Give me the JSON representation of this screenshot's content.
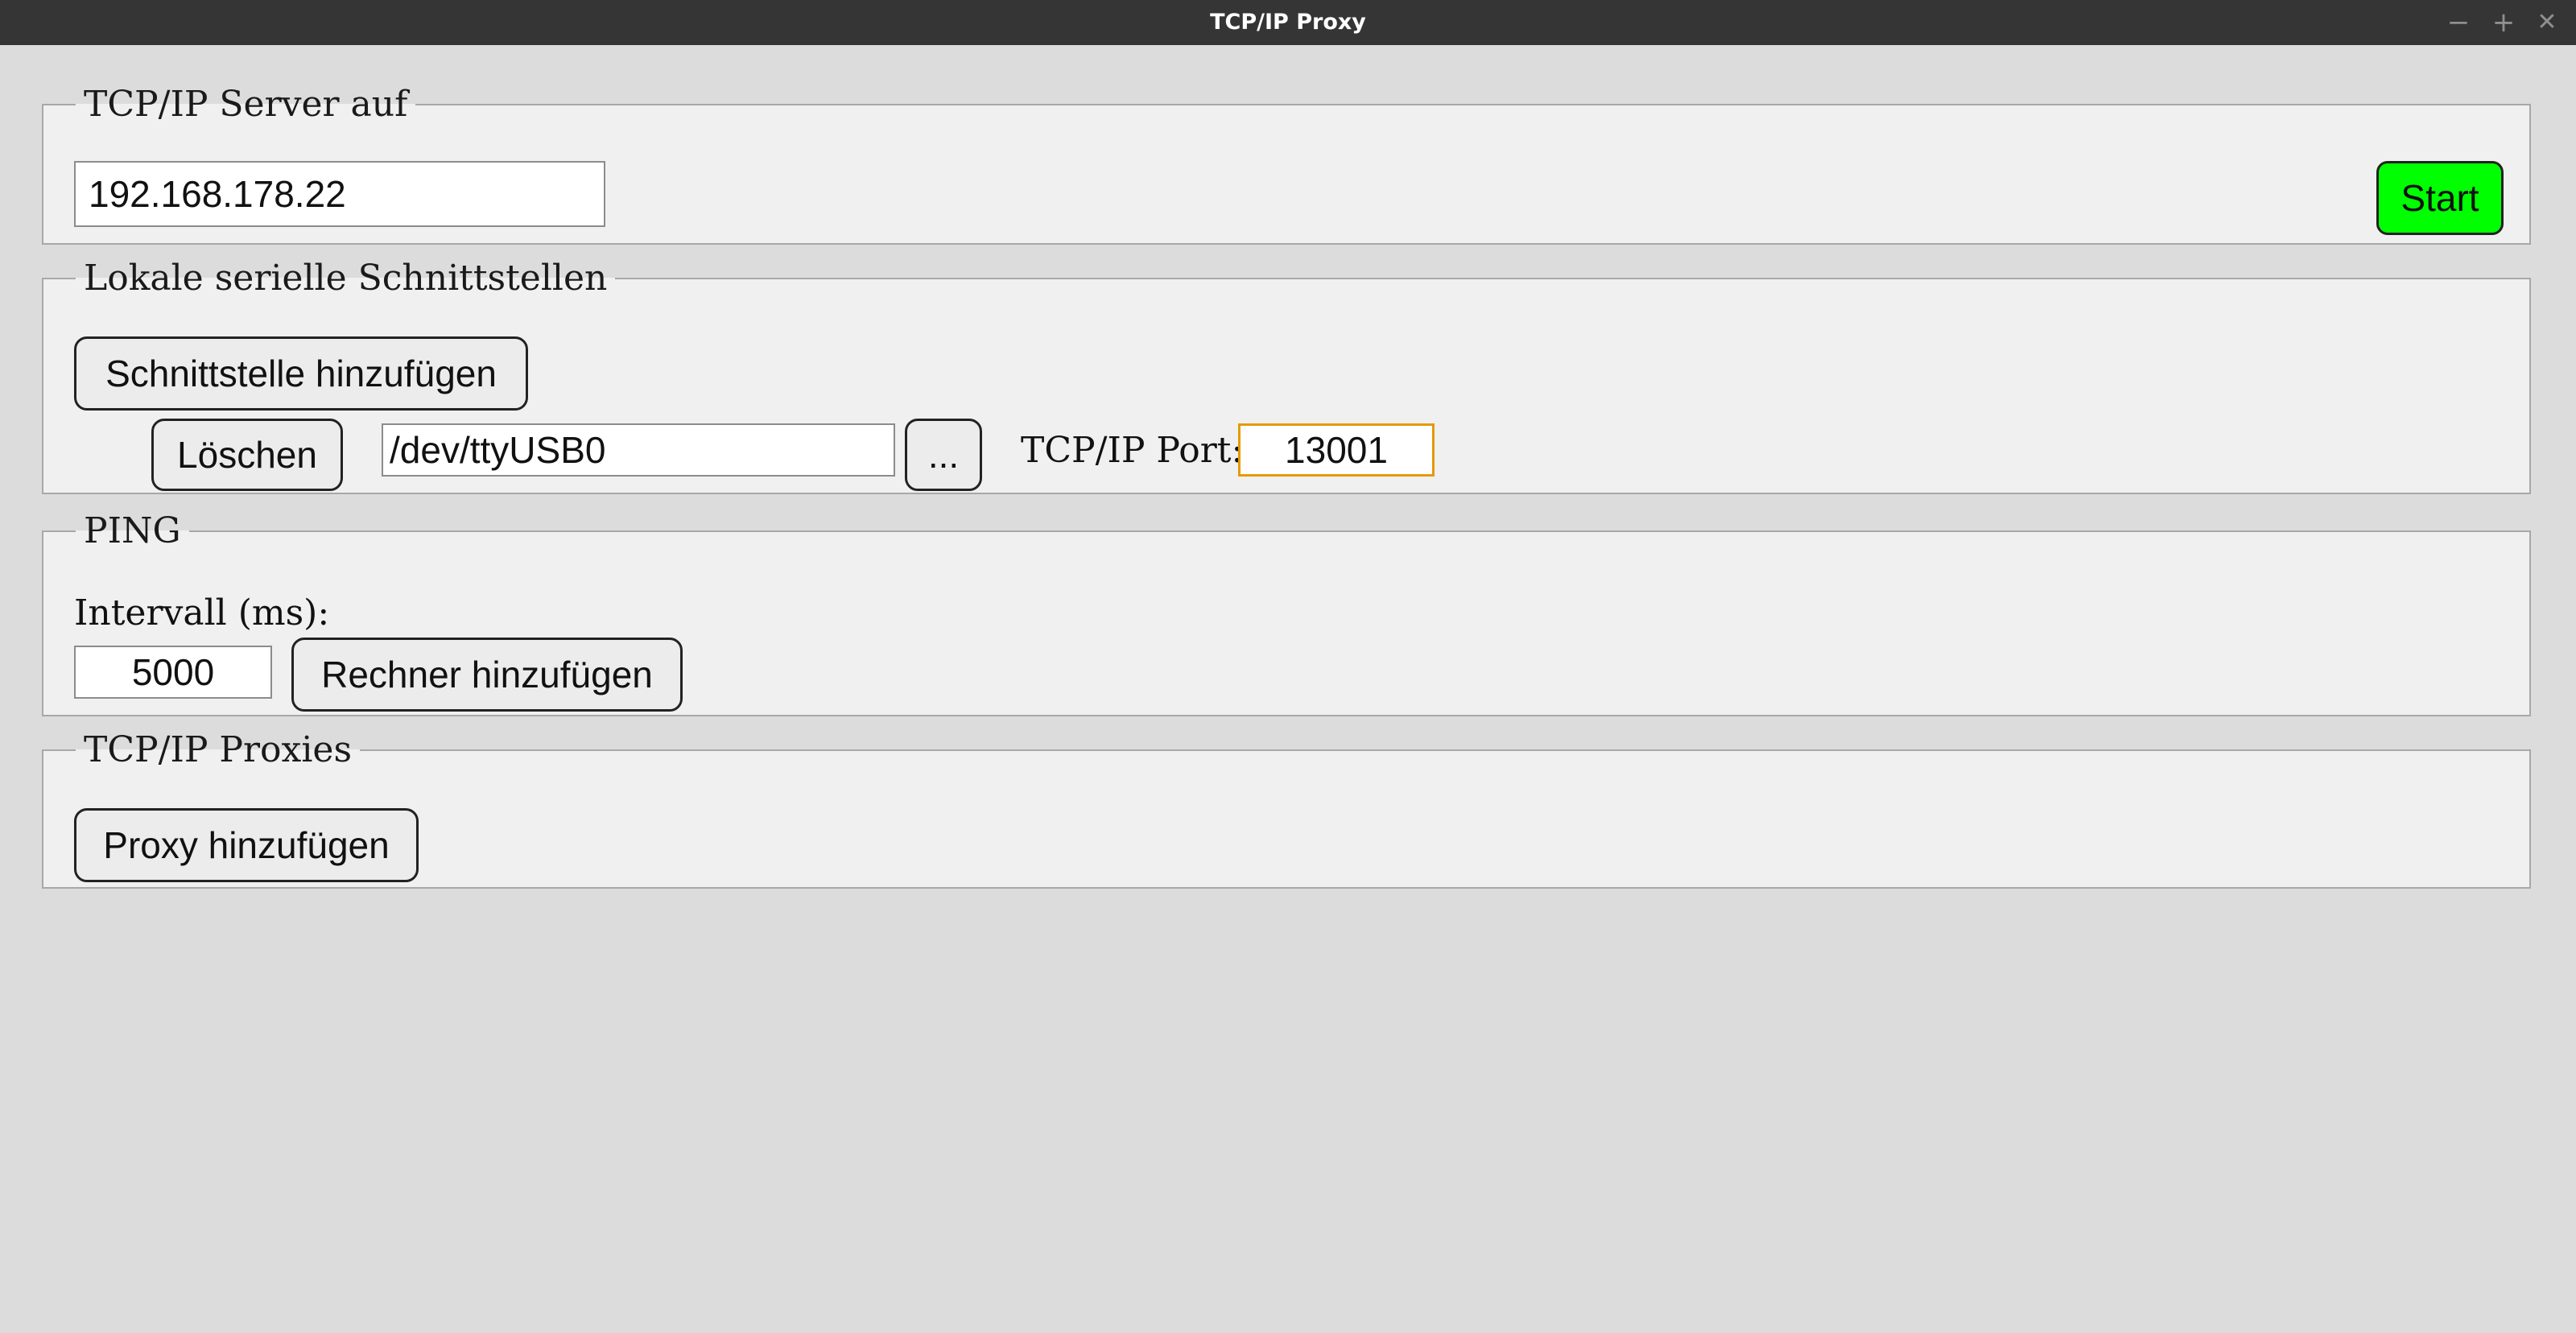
{
  "window": {
    "title": "TCP/IP Proxy",
    "controls": {
      "minimize": "−",
      "maximize": "+",
      "close": "✕"
    }
  },
  "server_group": {
    "legend": "TCP/IP Server auf",
    "address_value": "192.168.178.22",
    "start_label": "Start",
    "start_color": "#00ff00"
  },
  "serial_group": {
    "legend": "Lokale serielle Schnittstellen",
    "add_label": "Schnittstelle hinzufügen",
    "entries": [
      {
        "delete_label": "Löschen",
        "device_value": "/dev/ttyUSB0",
        "browse_label": "...",
        "port_label": "TCP/IP Port:",
        "port_value": "13001"
      }
    ]
  },
  "ping_group": {
    "legend": "PING",
    "interval_label": "Intervall (ms):",
    "interval_value": "5000",
    "add_host_label": "Rechner hinzufügen"
  },
  "proxies_group": {
    "legend": "TCP/IP Proxies",
    "add_proxy_label": "Proxy hinzufügen"
  },
  "colors": {
    "focus_border": "#e59a00",
    "titlebar": "#353535",
    "background": "#dcdcdc",
    "panel": "#f0f0f0"
  }
}
